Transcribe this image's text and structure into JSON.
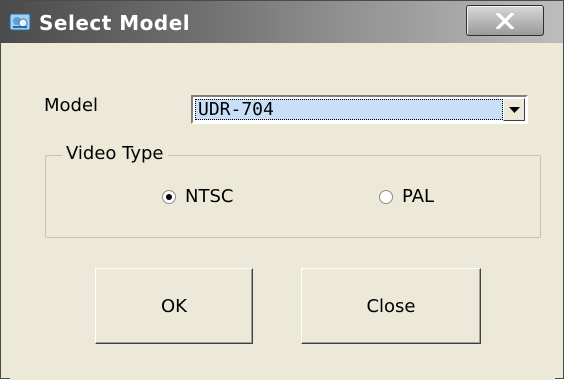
{
  "window": {
    "title": "Select Model",
    "close_glyph": "X",
    "icon": "app-icon"
  },
  "model": {
    "label": "Model",
    "selected": "UDR-704",
    "dropdown_icon": "chevron-down-icon"
  },
  "video_type": {
    "legend": "Video Type",
    "options": [
      {
        "label": "NTSC",
        "checked": true
      },
      {
        "label": "PAL",
        "checked": false
      }
    ]
  },
  "buttons": {
    "ok_label": "OK",
    "close_label": "Close"
  }
}
